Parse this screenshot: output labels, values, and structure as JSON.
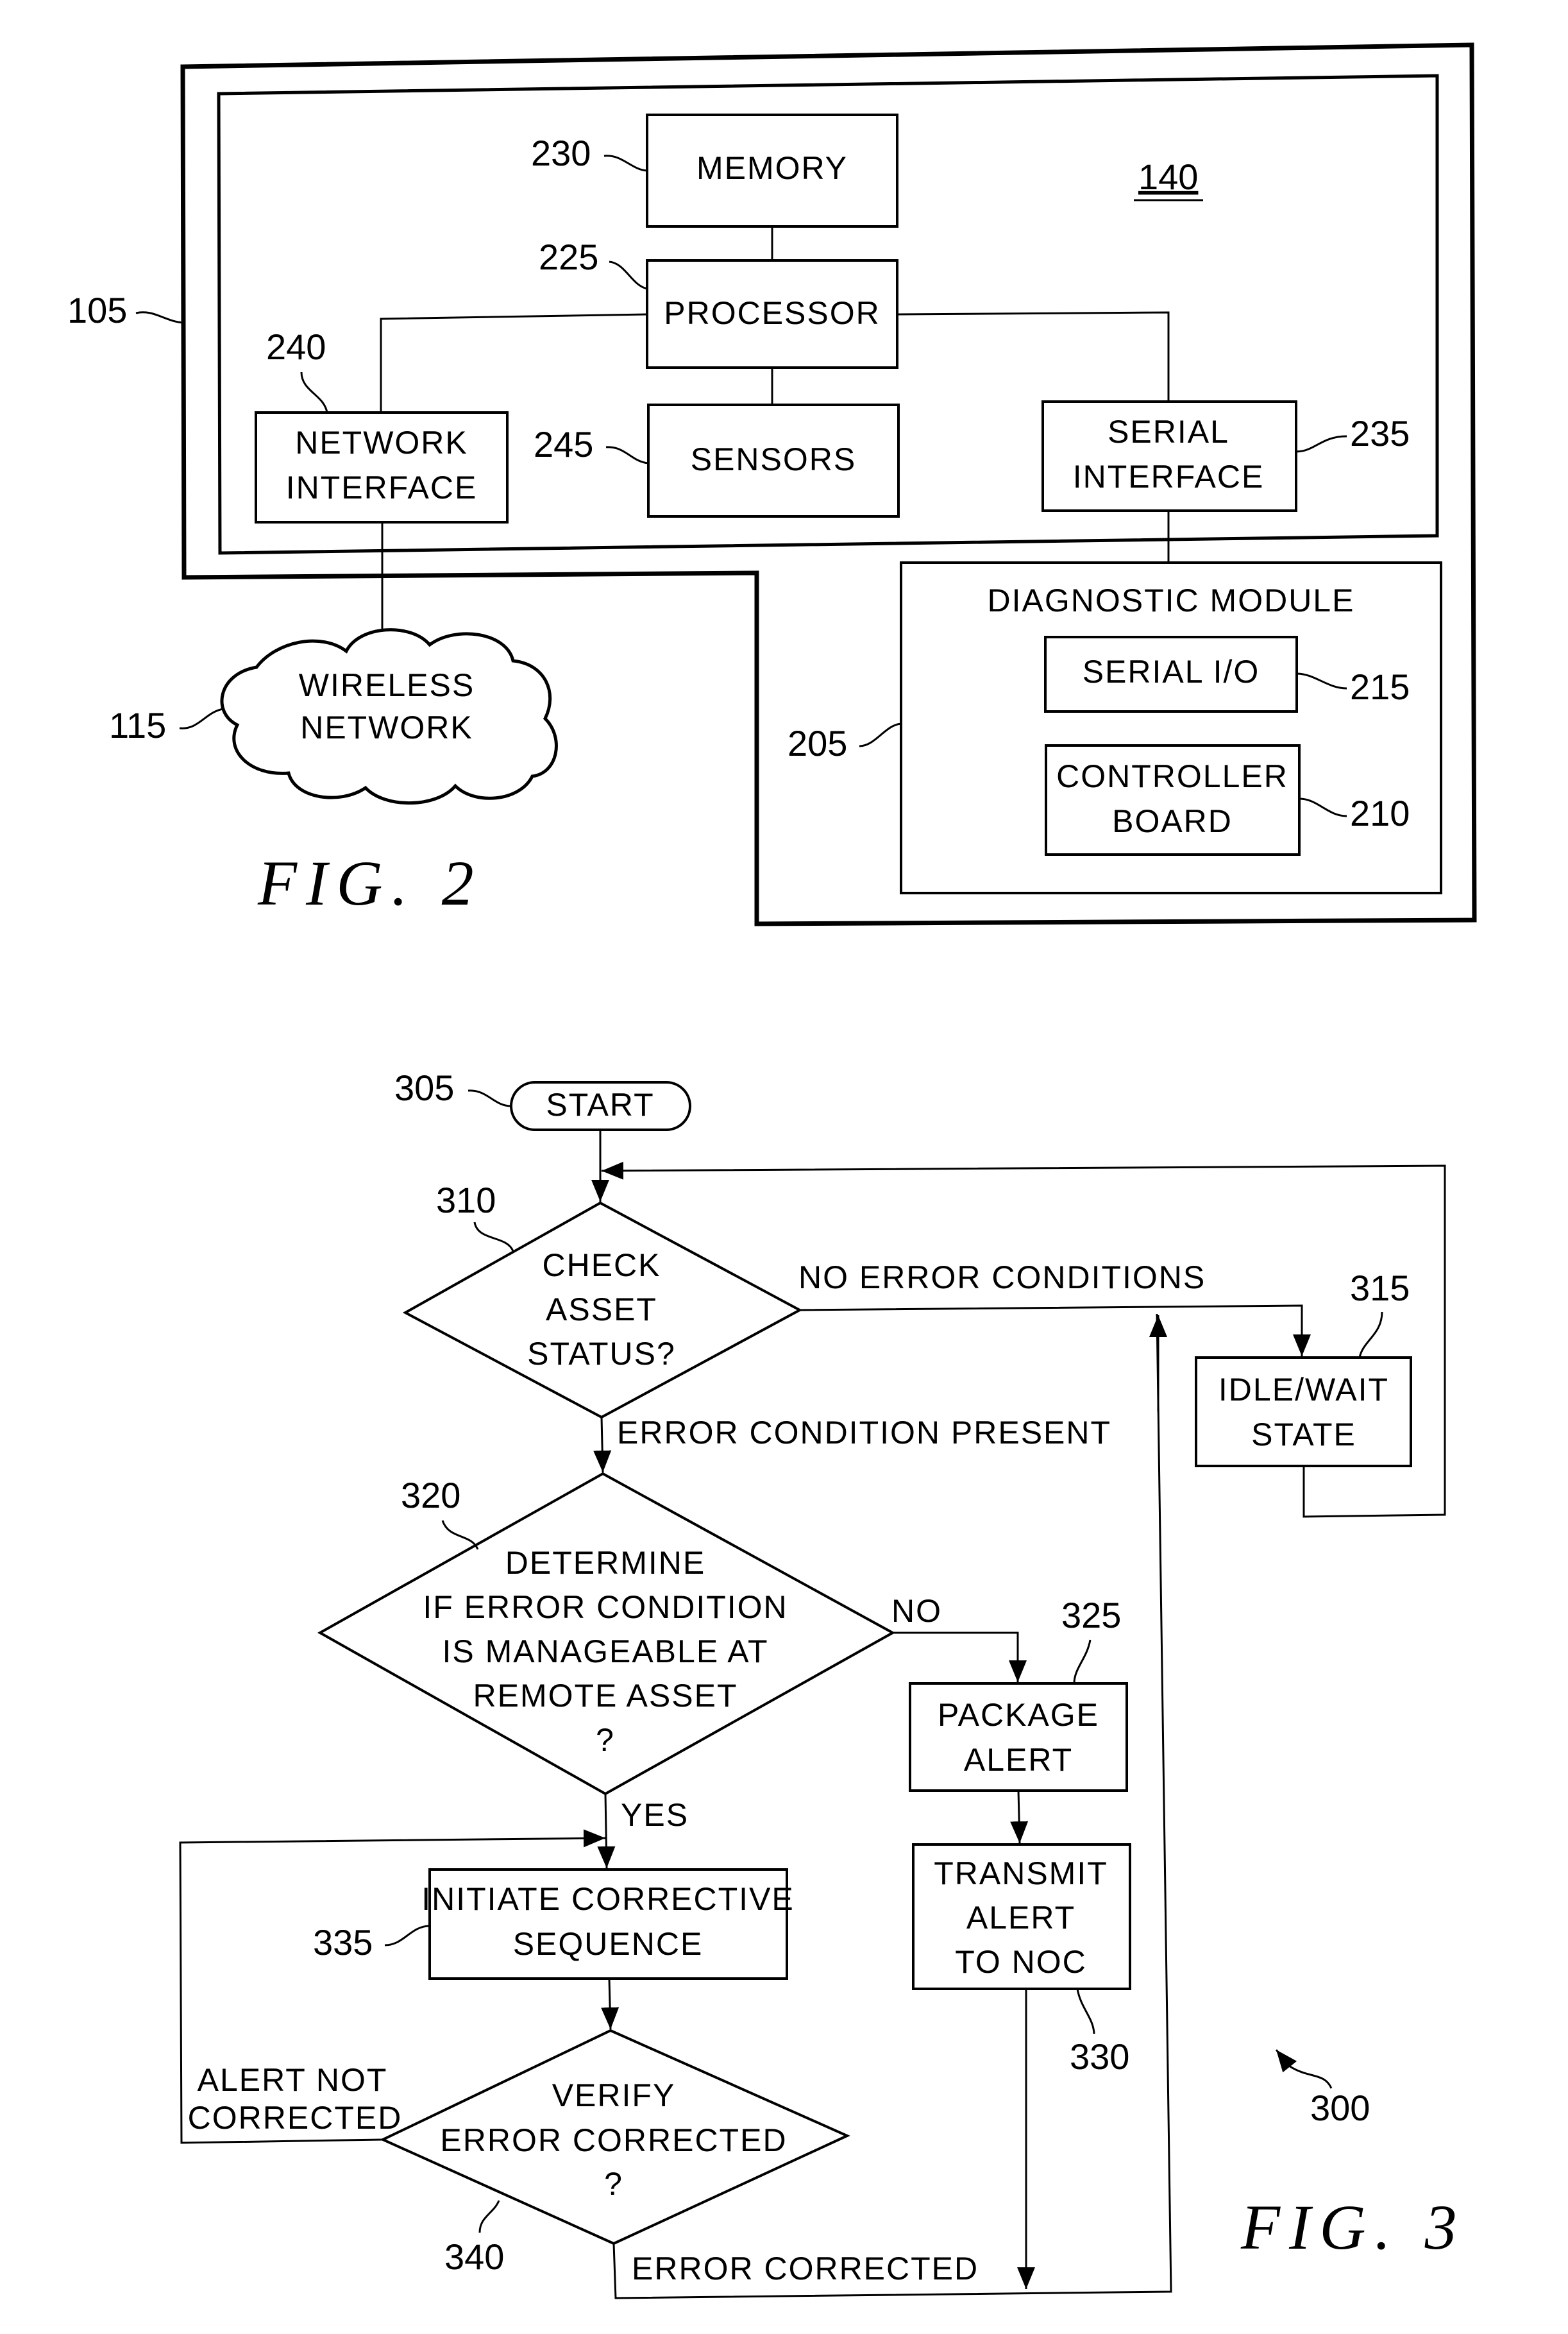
{
  "fig2": {
    "caption": "FIG. 2",
    "refs": {
      "device": "105",
      "unit": "140",
      "network": "115",
      "diagnostic": "205",
      "controller": "210",
      "serial_io": "215",
      "processor": "225",
      "memory": "230",
      "serial_interface": "235",
      "network_interface": "240",
      "sensors": "245"
    },
    "blocks": {
      "memory": [
        "MEMORY"
      ],
      "processor": [
        "PROCESSOR"
      ],
      "sensors": [
        "SENSORS"
      ],
      "network_interface": [
        "NETWORK",
        "INTERFACE"
      ],
      "serial_interface": [
        "SERIAL",
        "INTERFACE"
      ],
      "diagnostic_title": "DIAGNOSTIC MODULE",
      "serial_io": [
        "SERIAL I/O"
      ],
      "controller": [
        "CONTROLLER",
        "BOARD"
      ],
      "network": [
        "WIRELESS",
        "NETWORK"
      ]
    }
  },
  "fig3": {
    "caption": "FIG. 3",
    "refs": {
      "flow": "300",
      "start": "305",
      "check": "310",
      "idle": "315",
      "determine": "320",
      "package": "325",
      "transmit": "330",
      "initiate": "335",
      "verify": "340"
    },
    "nodes": {
      "start": [
        "START"
      ],
      "check": [
        "CHECK",
        "ASSET",
        "STATUS?"
      ],
      "idle": [
        "IDLE/WAIT",
        "STATE"
      ],
      "determine": [
        "DETERMINE",
        "IF ERROR CONDITION",
        "IS MANAGEABLE AT",
        "REMOTE ASSET",
        "?"
      ],
      "package": [
        "PACKAGE",
        "ALERT"
      ],
      "transmit": [
        "TRANSMIT",
        "ALERT",
        "TO NOC"
      ],
      "initiate": [
        "INITIATE CORRECTIVE",
        "SEQUENCE"
      ],
      "verify": [
        "VERIFY",
        "ERROR CORRECTED",
        "?"
      ]
    },
    "edges": {
      "no_error": "NO ERROR CONDITIONS",
      "error_present": "ERROR CONDITION PRESENT",
      "no": "NO",
      "yes": "YES",
      "alert_not_corrected": [
        "ALERT NOT",
        "CORRECTED"
      ],
      "error_corrected": "ERROR CORRECTED"
    }
  }
}
